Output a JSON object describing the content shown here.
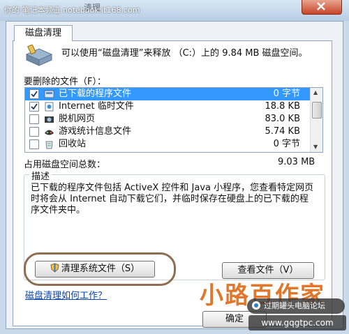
{
  "watermark": {
    "text": "你的·笔记本频道 notebook.it168.com"
  },
  "window": {
    "title": "清理"
  },
  "tab": {
    "label": "磁盘清理"
  },
  "summary": {
    "text": "可以使用“磁盘清理”来释放 （C:）上的 9.84 MB 磁盘空间。"
  },
  "files_section": {
    "label": "要删除的文件（F）："
  },
  "files": [
    {
      "name": "已下载的程序文件",
      "size": "0 字节",
      "checked": true,
      "selected": true,
      "icon": "program-files-icon"
    },
    {
      "name": "Internet 临时文件",
      "size": "18.8 KB",
      "checked": true,
      "selected": false,
      "icon": "internet-files-icon"
    },
    {
      "name": "脱机网页",
      "size": "83.0 KB",
      "checked": false,
      "selected": false,
      "icon": "offline-pages-icon"
    },
    {
      "name": "游戏统计信息文件",
      "size": "5.74 KB",
      "checked": false,
      "selected": false,
      "icon": "game-stats-icon"
    },
    {
      "name": "回收站",
      "size": "0 字节",
      "checked": false,
      "selected": false,
      "icon": "recycle-bin-icon"
    }
  ],
  "total": {
    "label": "占用磁盘空间总数：",
    "value": "9.03 MB"
  },
  "description": {
    "title": "描述",
    "text": "已下载的程序文件包括 ActiveX 控件和 Java 小程序，您查看特定网页时将会从 Internet 自动下载它们，并临时保存在硬盘上的已下载的程序文件夹中。"
  },
  "buttons": {
    "cleanup_system": "清理系统文件（S）",
    "view_files": "查看文件（V）",
    "ok": "确定"
  },
  "link": {
    "text": "磁盘清理如何工作？"
  },
  "overlay": {
    "brand": "小路百作家",
    "forum": "过期罐头电脑论坛",
    "url": "www.gqgtpc.com"
  },
  "colors": {
    "selection": "#3399ff",
    "accent": "#e2762a"
  }
}
